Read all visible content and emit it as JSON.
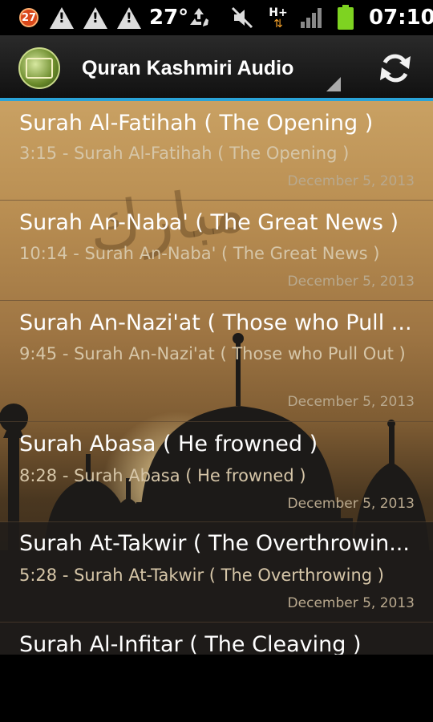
{
  "status_bar": {
    "notification_count": "27",
    "temperature": "27°",
    "time": "07:10",
    "network_label": "H+"
  },
  "app_bar": {
    "title": "Quran Kashmiri  Audio"
  },
  "icons": {
    "logo": "quran-logo-icon",
    "refresh": "refresh-icon",
    "spinner": "dropdown-triangle-icon"
  },
  "surahs": [
    {
      "title": "Surah Al-Fatihah ( The Opening )",
      "subtitle": "3:15 - Surah Al-Fatihah ( The Opening )",
      "date": "December 5, 2013"
    },
    {
      "title": "Surah An-Naba' ( The Great News )",
      "subtitle": "10:14 - Surah An-Naba' ( The Great News )",
      "date": "December 5, 2013"
    },
    {
      "title": "Surah An-Nazi'at ( Those who Pull ...",
      "subtitle": "9:45 - Surah An-Nazi'at ( Those who Pull Out )",
      "date": "December 5, 2013"
    },
    {
      "title": "Surah Abasa ( He frowned )",
      "subtitle": "8:28 - Surah Abasa ( He frowned )",
      "date": "December 5, 2013"
    },
    {
      "title": "Surah At-Takwir ( The Overthrowin...",
      "subtitle": "5:28 - Surah At-Takwir ( The Overthrowing )",
      "date": "December 5, 2013"
    },
    {
      "title": "Surah Al-Infitar ( The Cleaving )",
      "subtitle": "",
      "date": ""
    }
  ],
  "colors": {
    "accent": "#2aa3d8",
    "title_text": "#ffffff",
    "subtitle_text": "#d6c6a8",
    "date_text": "#b9a98e"
  }
}
